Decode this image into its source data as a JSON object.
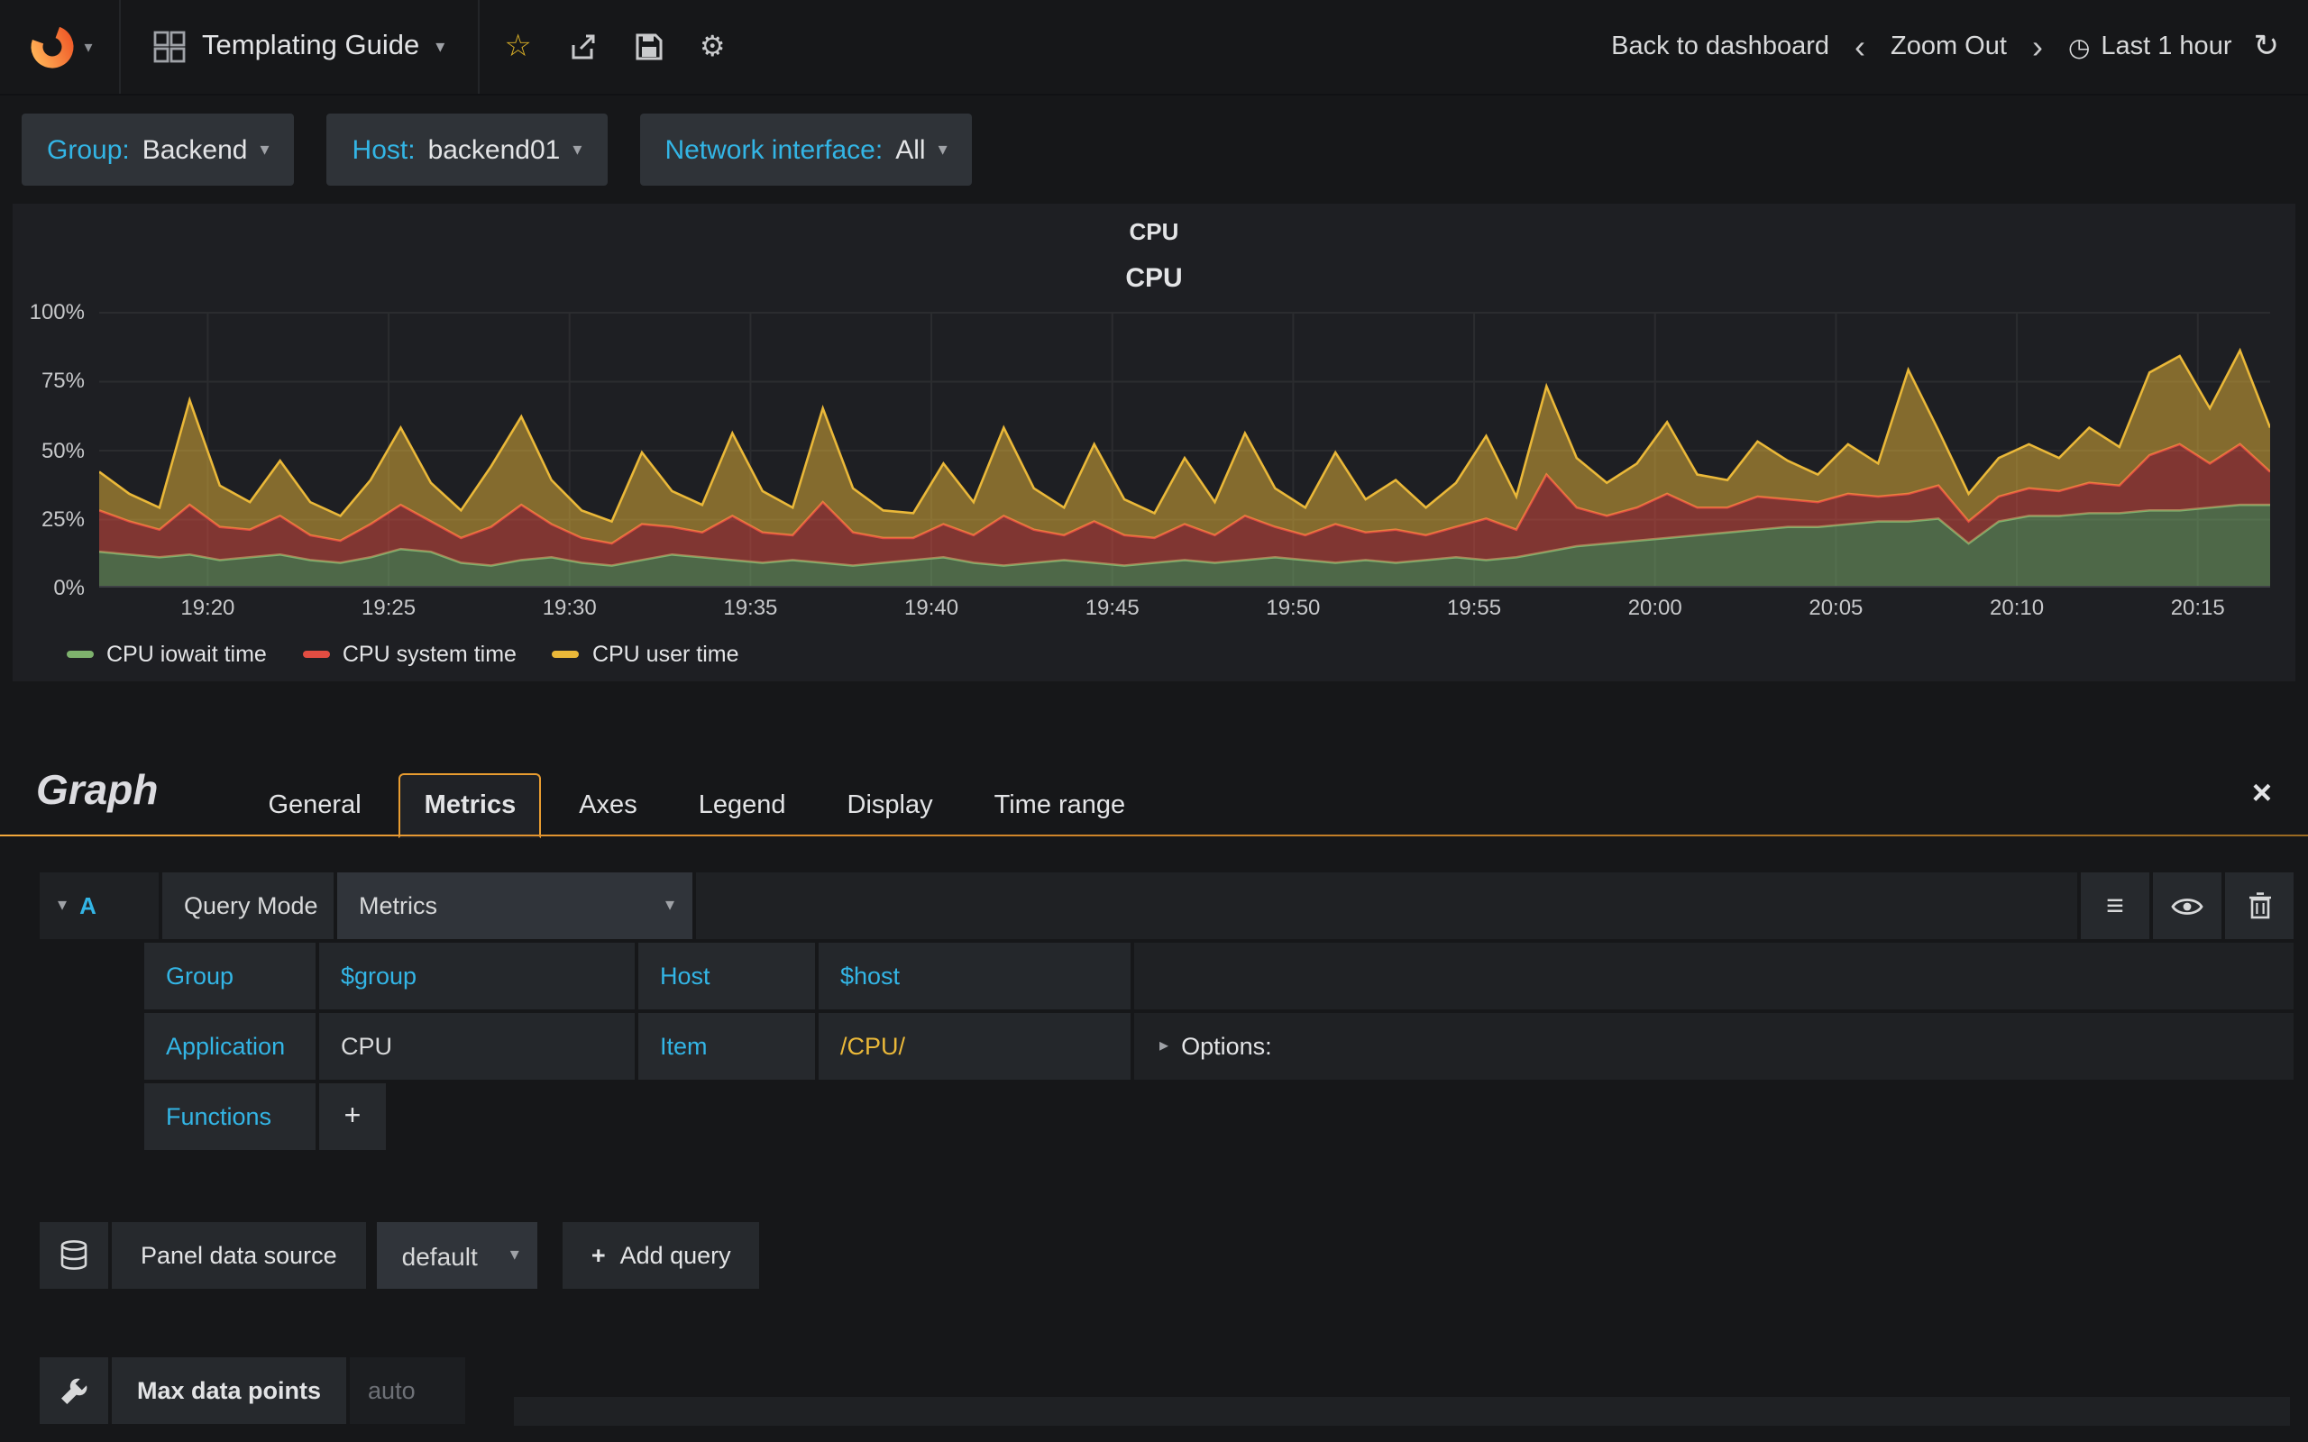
{
  "navbar": {
    "dashboard_title": "Templating Guide",
    "back_to_dashboard": "Back to dashboard",
    "zoom_out": "Zoom Out",
    "time_range": "Last 1 hour"
  },
  "icons": {
    "caret_down": "▾",
    "caret_right": "▸",
    "star": "☆",
    "gear": "⚙",
    "chevron_left": "‹",
    "chevron_right": "›",
    "clock": "◷",
    "refresh": "↻",
    "hamburger": "≡",
    "plus": "+",
    "close": "×"
  },
  "variables": [
    {
      "label": "Group:",
      "value": "Backend"
    },
    {
      "label": "Host:",
      "value": "backend01"
    },
    {
      "label": "Network interface:",
      "value": "All"
    }
  ],
  "panel": {
    "title": "CPU"
  },
  "chart_data": {
    "type": "area",
    "stacked": true,
    "title": "CPU",
    "ylabel": "",
    "xlabel": "",
    "ylim": [
      0,
      100
    ],
    "yticks": [
      "0%",
      "25%",
      "50%",
      "75%",
      "100%"
    ],
    "x_start": "19:17",
    "x_end": "20:17",
    "xticks": [
      "19:20",
      "19:25",
      "19:30",
      "19:35",
      "19:40",
      "19:45",
      "19:50",
      "19:55",
      "20:00",
      "20:05",
      "20:10",
      "20:15"
    ],
    "grid": true,
    "legend_position": "bottom-left",
    "series": [
      {
        "name": "CPU iowait time",
        "color": "#7eb26d",
        "values": [
          13,
          12,
          11,
          12,
          10,
          11,
          12,
          10,
          9,
          11,
          14,
          13,
          9,
          8,
          10,
          11,
          9,
          8,
          10,
          12,
          11,
          10,
          9,
          10,
          9,
          8,
          9,
          10,
          11,
          9,
          8,
          9,
          10,
          9,
          8,
          9,
          10,
          9,
          10,
          11,
          10,
          9,
          10,
          9,
          10,
          11,
          10,
          11,
          13,
          15,
          16,
          17,
          18,
          19,
          20,
          21,
          22,
          22,
          23,
          24,
          24,
          25,
          16,
          24,
          26,
          26,
          27,
          27,
          28,
          28,
          29,
          30,
          30
        ]
      },
      {
        "name": "CPU system time",
        "color": "#e24d42",
        "values": [
          15,
          12,
          10,
          18,
          12,
          10,
          14,
          9,
          8,
          12,
          16,
          11,
          9,
          14,
          20,
          12,
          9,
          8,
          13,
          10,
          9,
          16,
          11,
          9,
          22,
          12,
          9,
          8,
          12,
          10,
          18,
          12,
          9,
          15,
          11,
          9,
          13,
          10,
          16,
          11,
          9,
          14,
          10,
          12,
          9,
          11,
          15,
          10,
          28,
          14,
          10,
          12,
          16,
          10,
          9,
          12,
          10,
          9,
          11,
          9,
          10,
          12,
          8,
          9,
          10,
          9,
          11,
          10,
          20,
          24,
          16,
          22,
          12
        ]
      },
      {
        "name": "CPU user time",
        "color": "#eab839",
        "values": [
          14,
          10,
          8,
          38,
          15,
          10,
          20,
          12,
          9,
          16,
          28,
          14,
          10,
          22,
          32,
          16,
          10,
          8,
          26,
          13,
          10,
          30,
          15,
          10,
          34,
          16,
          10,
          9,
          22,
          12,
          32,
          15,
          10,
          28,
          13,
          9,
          24,
          12,
          30,
          14,
          10,
          26,
          12,
          18,
          10,
          16,
          30,
          12,
          32,
          18,
          12,
          16,
          26,
          12,
          10,
          20,
          14,
          10,
          18,
          12,
          45,
          20,
          10,
          14,
          16,
          12,
          20,
          14,
          30,
          32,
          20,
          34,
          16
        ]
      }
    ]
  },
  "editor": {
    "panel_type": "Graph",
    "tabs": [
      "General",
      "Metrics",
      "Axes",
      "Legend",
      "Display",
      "Time range"
    ],
    "active_tab": "Metrics",
    "query": {
      "letter": "A",
      "mode_label": "Query Mode",
      "mode_value": "Metrics",
      "group_label": "Group",
      "group_value": "$group",
      "host_label": "Host",
      "host_value": "$host",
      "application_label": "Application",
      "application_value": "CPU",
      "item_label": "Item",
      "item_value": "/CPU/",
      "options_label": "Options:",
      "functions_label": "Functions"
    },
    "datasource": {
      "label": "Panel data source",
      "value": "default",
      "add_query_label": "Add query"
    },
    "max_data_points": {
      "label": "Max data points",
      "placeholder": "auto"
    }
  }
}
